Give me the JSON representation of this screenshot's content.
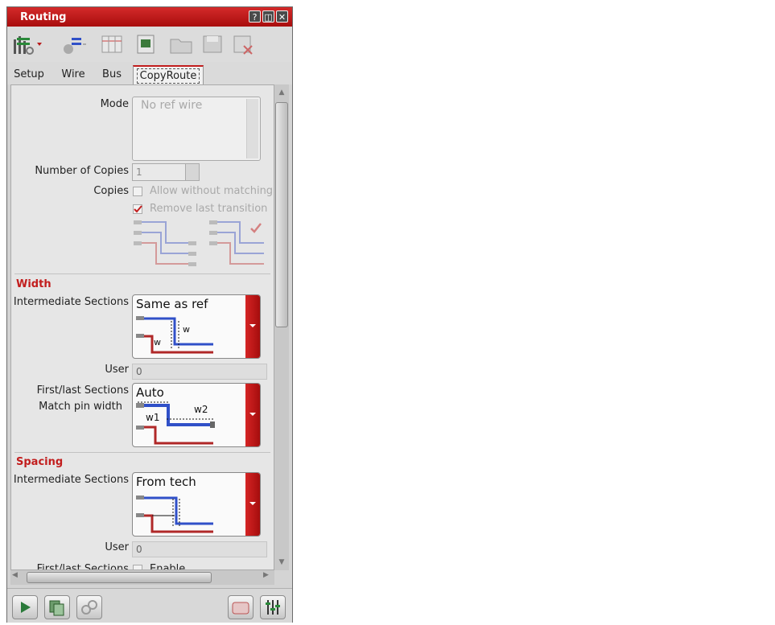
{
  "window": {
    "title": "Routing",
    "help_glyph": "?",
    "restore_glyph": "◫",
    "close_glyph": "✕"
  },
  "tabs": [
    {
      "label": "Setup"
    },
    {
      "label": "Wire"
    },
    {
      "label": "Bus"
    },
    {
      "label": "CopyRoute"
    }
  ],
  "copyroute": {
    "mode_label": "Mode",
    "mode_value": "No ref wire",
    "copies_count_label": "Number of Copies",
    "copies_count_value": "1",
    "copies_label": "Copies",
    "allow_without_matching": "Allow without matching",
    "remove_last_transition": "Remove last transition"
  },
  "width": {
    "section_title": "Width",
    "intermediate_label": "Intermediate Sections",
    "intermediate_value": "Same as ref",
    "user_label": "User",
    "user_value": "0",
    "firstlast_label": "First/last Sections",
    "match_pin_label": "Match pin width",
    "firstlast_value": "Auto",
    "w_label": "w",
    "w1_label": "w1",
    "w2_label": "w2"
  },
  "spacing": {
    "section_title": "Spacing",
    "intermediate_label": "Intermediate Sections",
    "intermediate_value": "From tech",
    "user_label": "User",
    "user_value": "0",
    "firstlast_label": "First/last Sections",
    "enable_label": "Enable"
  },
  "colors": {
    "accent": "#c21d1d",
    "wire_blue": "#3050c8",
    "wire_red": "#b02828"
  }
}
